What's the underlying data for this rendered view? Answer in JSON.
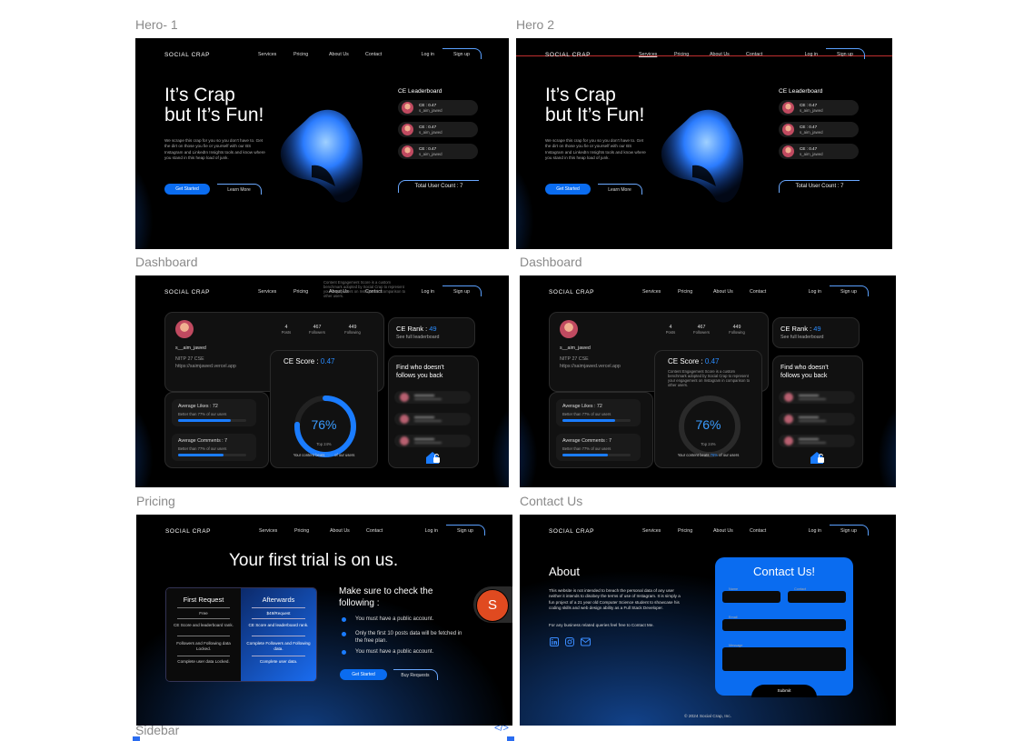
{
  "frames": {
    "hero1": "Hero- 1",
    "hero2": "Hero 2",
    "dash1": "Dashboard",
    "dash2": "Dashboard",
    "pricing": "Pricing",
    "contact": "Contact Us",
    "sidebar": "Sidebar",
    "code_icon": "</>"
  },
  "nav": {
    "logo": "SOCIAL CRAP",
    "links": [
      "Services",
      "Pricing",
      "About Us",
      "Contact"
    ],
    "login": "Log in",
    "signup": "Sign up"
  },
  "hero": {
    "title_line1": "It’s Crap",
    "title_line2": "but It’s Fun!",
    "description": "We scrape this crap for you so you don't have to. Get the dirt on those you fie or yourself with our BS Instagram and LinkedIn Insights tools and know where you stand in this heap load of junk.",
    "get_started": "Get Started",
    "learn_more": "Learn More",
    "leaderboard_title": "CE Leaderboard",
    "leaderboard": [
      {
        "score": "CE : 0.47",
        "user": "s_aim_jawed"
      },
      {
        "score": "CE : 0.47",
        "user": "s_aim_jawed"
      },
      {
        "score": "CE : 0.47",
        "user": "s_aim_jawed"
      }
    ],
    "user_count": "Total User Count : 7"
  },
  "dashboard": {
    "posts_value": "4",
    "posts_label": "Posts",
    "followers_value": "467",
    "followers_label": "Followers",
    "following_value": "449",
    "following_label": "Following",
    "username": "s__aim_jawed",
    "bio1": "NITP 27 CSE",
    "bio2": "https://saimjawed.vercel.app",
    "rank_label": "CE Rank : ",
    "rank_value": "49",
    "rank_link": "See full leaderboard",
    "score_label": "CE Score : ",
    "score_value": "0.47",
    "score_desc": "Content Engagement Score is a custom benchmark adopted by Social Crap to represent your engagement on Instagram in comparison to other users.",
    "percent": "76%",
    "percent_fraction": 0.76,
    "top_text": "Top 24%",
    "beats_prefix": "Your content beats ",
    "beats_value": "76%",
    "beats_suffix": " of our users",
    "avg_likes": "Average Likes : 72",
    "avg_likes_sub": "Better than 77% of our users",
    "avg_likes_fraction": 0.77,
    "avg_comments": "Average Comments : 7",
    "avg_comments_sub": "Better than 77% of our users",
    "avg_comments_fraction": 0.66,
    "find_title1": "Find who doesn't",
    "find_title2": "follows you back"
  },
  "pricing": {
    "headline": "Your first trial is on us.",
    "col1_title": "First Request",
    "col1_items": [
      "Free",
      "CE Score and leaderboard rank.",
      "Followers and Following data Locked.",
      "Complete user data Locked."
    ],
    "col2_title": "Afterwards",
    "col2_items": [
      "$49/Request",
      "CE Score and leaderboard rank.",
      "Complete Followers and Following data.",
      "Complete user data."
    ],
    "check_title1": "Make sure to check the",
    "check_title2": "following :",
    "bullets": [
      "You must have a public account.",
      "Only the first 10 posts data will be fetched in the free plan.",
      "You must have a public account."
    ],
    "get_started": "Get Started",
    "buy_requests": "Buy Requests",
    "avatar_letter": "S"
  },
  "contact": {
    "about_title": "About",
    "about_text": "This website is not intended to breach the personal data of any user neither it intends to disobey the terms of use of Instagram. It is simply a fun project of a 21 year old Computer Science student to showcase his coding skills and web design ability as a Full Stack Developer.",
    "about_text2": "For any business related queries feel free to Contact Me.",
    "form_title": "Contact Us!",
    "name_label": "Name",
    "contact_label": "Contact",
    "email_label": "Email",
    "message_label": "Message",
    "submit": "Submit",
    "footer": "© 2024 Social Crap, Inc."
  },
  "colors": {
    "accent": "#0a6cf0",
    "background": "#000000"
  }
}
